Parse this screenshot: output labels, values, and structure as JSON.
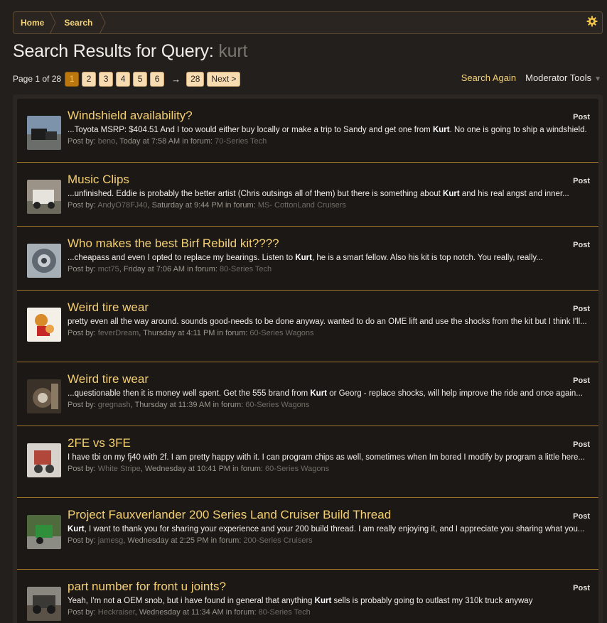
{
  "breadcrumb": {
    "home": "Home",
    "current": "Search"
  },
  "header": {
    "title_prefix": "Search Results for Query:",
    "query": "kurt"
  },
  "pagination": {
    "label": "Page 1 of 28",
    "pages": [
      "1",
      "2",
      "3",
      "4",
      "5",
      "6"
    ],
    "current": "1",
    "arrow": "→",
    "last": "28",
    "next": "Next >"
  },
  "tools": {
    "search_again": "Search Again",
    "moderator_tools": "Moderator Tools"
  },
  "results": [
    {
      "title": "Windshield availability?",
      "snippet_before": "...Toyota MSRP: $404.51 And I too would either buy locally or make a trip to Sandy and get one from ",
      "highlight": "Kurt",
      "snippet_after": ". No one is going to ship a windshield.",
      "meta_prefix": "Post by:",
      "user": "beno",
      "time": ", Today at 7:58 AM in forum:",
      "forum": "70-Series Tech",
      "type": "Post"
    },
    {
      "title": "Music Clips",
      "snippet_before": "...unfinished. Eddie is probably the better artist (Chris outsings all of them) but there is something about ",
      "highlight": "Kurt",
      "snippet_after": " and his real angst and inner...",
      "meta_prefix": "Post by:",
      "user": "AndyO78FJ40",
      "time": ", Saturday at 9:44 PM in forum:",
      "forum": "MS- CottonLand Cruisers",
      "type": "Post"
    },
    {
      "title": "Who makes the best Birf Rebild kit????",
      "snippet_before": "...cheapass and even I opted to replace my bearings. Listen to ",
      "highlight": "Kurt",
      "snippet_after": ", he is a smart fellow. Also his kit is top notch. You really, really...",
      "meta_prefix": "Post by:",
      "user": "mct75",
      "time": ", Friday at 7:06 AM in forum:",
      "forum": "80-Series Tech",
      "type": "Post"
    },
    {
      "title": "Weird tire wear",
      "snippet_before": "pretty even all the way around. sounds good-needs to be done anyway. wanted to do an OME lift and use the shocks from the kit but I think I'll...",
      "highlight": "",
      "snippet_after": "",
      "meta_prefix": "Post by:",
      "user": "feverDream",
      "time": ", Thursday at 4:11 PM in forum:",
      "forum": "60-Series Wagons",
      "type": "Post"
    },
    {
      "title": "Weird tire wear",
      "snippet_before": "...questionable then it is money well spent. Get the 555 brand from ",
      "highlight": "Kurt",
      "snippet_after": " or Georg - replace shocks, will help improve the ride and once again...",
      "meta_prefix": "Post by:",
      "user": "gregnash",
      "time": ", Thursday at 11:39 AM in forum:",
      "forum": "60-Series Wagons",
      "type": "Post"
    },
    {
      "title": "2FE vs 3FE",
      "snippet_before": "I have tbi on my fj40 with 2f. I am pretty happy with it. I can program chips as well, sometimes when Im bored I modify by program a little here...",
      "highlight": "",
      "snippet_after": "",
      "meta_prefix": "Post by:",
      "user": "White Stripe",
      "time": ", Wednesday at 10:41 PM in forum:",
      "forum": "60-Series Wagons",
      "type": "Post"
    },
    {
      "title": "Project Fauxverlander 200 Series Land Cruiser Build Thread",
      "snippet_before": "",
      "highlight": "Kurt",
      "snippet_after": ", I want to thank you for sharing your experience and your 200 build thread. I am really enjoying it, and I appreciate you sharing what you...",
      "meta_prefix": "Post by:",
      "user": "jamesg",
      "time": ", Wednesday at 2:25 PM in forum:",
      "forum": "200-Series Cruisers",
      "type": "Post"
    },
    {
      "title": "part number for front u joints?",
      "snippet_before": "Yeah, I'm not a OEM snob, but i have found in general that anything ",
      "highlight": "Kurt",
      "snippet_after": " sells is probably going to outlast my 310k truck anyway",
      "meta_prefix": "Post by:",
      "user": "Heckraiser",
      "time": ", Wednesday at 11:34 AM in forum:",
      "forum": "80-Series Tech",
      "type": "Post"
    }
  ]
}
